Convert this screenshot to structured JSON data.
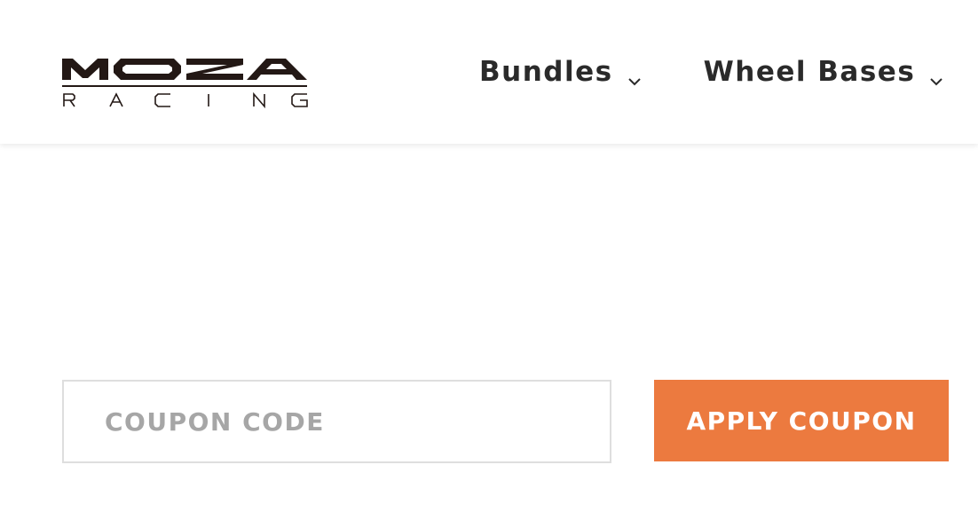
{
  "brand": {
    "name": "MOZA",
    "tagline": "RACING"
  },
  "nav": {
    "items": [
      {
        "label": "Bundles",
        "icon": "chevron-down-icon"
      },
      {
        "label": "Wheel Bases",
        "icon": "chevron-down-icon"
      }
    ]
  },
  "coupon": {
    "placeholder": "COUPON CODE",
    "value": "",
    "button_label": "APPLY COUPON"
  },
  "colors": {
    "accent": "#ec7a3f",
    "text_dark": "#2a2a2a",
    "placeholder": "#a6a6a6",
    "border": "#dedede"
  }
}
